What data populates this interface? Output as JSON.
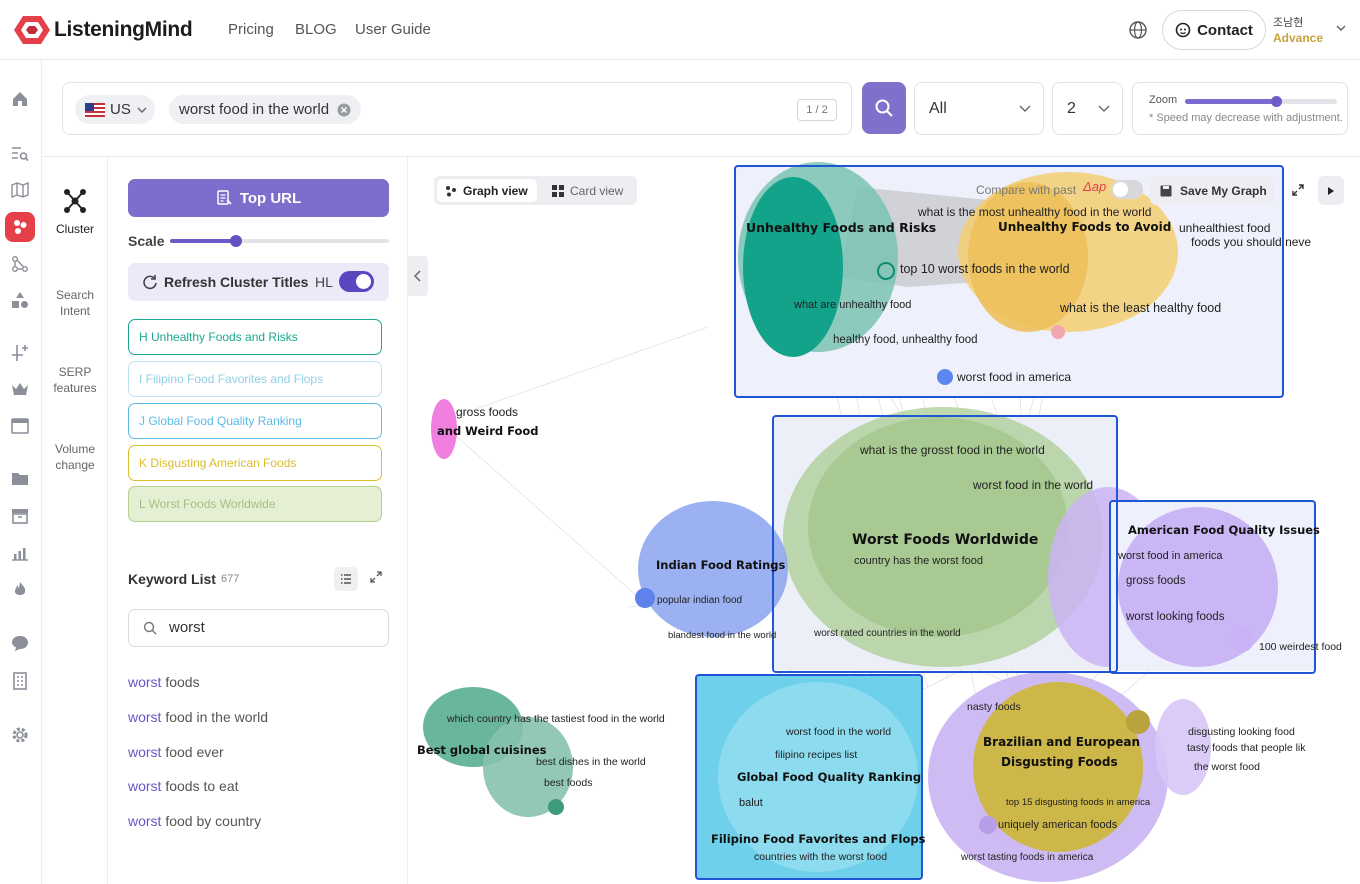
{
  "app": {
    "name": "ListeningMind"
  },
  "topnav": {
    "pricing": "Pricing",
    "blog": "BLOG",
    "guide": "User Guide"
  },
  "header": {
    "contact": "Contact",
    "user_name": "조남현",
    "user_plan": "Advance"
  },
  "colors": {
    "brand": "#e5404a",
    "accent": "#7d6dcc",
    "selection_box": "#1f56d6"
  },
  "rail_icons": [
    "home-icon",
    "search-list-icon",
    "map-icon",
    "cluster-icon",
    "path-icon",
    "shapes-icon",
    "grid-plus-icon",
    "crown-icon",
    "archive-icon",
    "folder-icon",
    "box-icon",
    "chart-icon",
    "fire-icon",
    "chat-icon",
    "building-icon",
    "gear-icon"
  ],
  "search": {
    "country": "US",
    "keyword": "worst food in the world",
    "page_counter": "1 / 2",
    "filter_select": "All",
    "depth_select": "2",
    "zoom_label": "Zoom",
    "zoom_value": 0.6,
    "zoom_note": "* Speed may decrease with adjustment."
  },
  "subnav": [
    {
      "label": "Cluster"
    },
    {
      "label": "Search Intent"
    },
    {
      "label": "SERP features"
    },
    {
      "label": "Volume change"
    }
  ],
  "panel": {
    "top_url": "Top URL",
    "scale_label": "Scale",
    "scale_value": 0.3,
    "refresh_label": "Refresh Cluster Titles",
    "hl_label": "HL",
    "clusters": [
      {
        "label": "H Unhealthy Foods and Risks",
        "color": "#1aa98f"
      },
      {
        "label": "I Filipino Food Favorites and Flops",
        "color": "#9fd8ec"
      },
      {
        "label": "J Global Food Quality Ranking",
        "color": "#5cbbe6"
      },
      {
        "label": "K Disgusting American Foods",
        "color": "#d9bd2d"
      },
      {
        "label": "L Worst Foods Worldwide",
        "color": "#b4d08c"
      }
    ],
    "keyword_list_title": "Keyword List",
    "keyword_count": "677",
    "filter_value": "worst",
    "keywords": [
      {
        "hit": "worst",
        "rest": " foods"
      },
      {
        "hit": "worst",
        "rest": " food in the world"
      },
      {
        "hit": "worst",
        "rest": " food ever"
      },
      {
        "hit": "worst",
        "rest": " foods to eat"
      },
      {
        "hit": "worst",
        "rest": " food by country"
      }
    ]
  },
  "graph": {
    "graph_view": "Graph view",
    "card_view": "Card view",
    "compare_label": "Compare with past",
    "compare_marker": "Δap",
    "save_label": "Save My Graph",
    "labels": {
      "unhealthy_title": "Unhealthy Foods and Risks",
      "avoid_title": "Unhealthy Foods to Avoid",
      "most_unhealthy": "what is the most unhealthy food in the world",
      "unhealthiest": "unhealthiest food",
      "foods_should": "foods you should neve",
      "top10": "top 10 worst foods in the world",
      "what_unhealthy": "what are unhealthy food",
      "least_healthy": "what is the least healthy food",
      "healthy_unhealthy": "healthy food, unhealthy food",
      "worst_america": "worst food in america",
      "gross_foods": "gross foods",
      "weird_title": "and Weird Food",
      "grosst": "what is the grosst food in the world",
      "worst_world": "worst food in the world",
      "worldwide_title": "Worst Foods Worldwide",
      "country_worst": "country has the worst food",
      "rated_countries": "worst rated countries in the world",
      "indian_title": "Indian Food Ratings",
      "popular_indian": "popular indian food",
      "blandest": "blandest food in the world",
      "american_title": "American Food Quality Issues",
      "am_worst_america": "worst food in america",
      "am_gross": "gross foods",
      "worst_looking": "worst looking foods",
      "weirdest": "100 weirdest food",
      "tastiest": "which country has the tastiest food in the world",
      "best_global_title": "Best global cuisines",
      "best_dishes": "best dishes in the world",
      "best_foods": "best foods",
      "gq_worst_world": "worst food in the world",
      "filipino_recipes": "filipino recipes list",
      "gq_title": "Global Food Quality Ranking",
      "balut": "balut",
      "filipino_title": "Filipino Food Favorites and Flops",
      "countries_worst": "countries with the worst food",
      "nasty": "nasty foods",
      "brazil_title_1": "Brazilian and European",
      "brazil_title_2": "Disgusting Foods",
      "top15": "top 15 disgusting foods in america",
      "uniquely": "uniquely american foods",
      "tasting": "worst tasting foods in america",
      "disgusting_looking": "disgusting looking food",
      "tasty_people": "tasty foods that people lik",
      "the_worst": "the worst food"
    }
  }
}
